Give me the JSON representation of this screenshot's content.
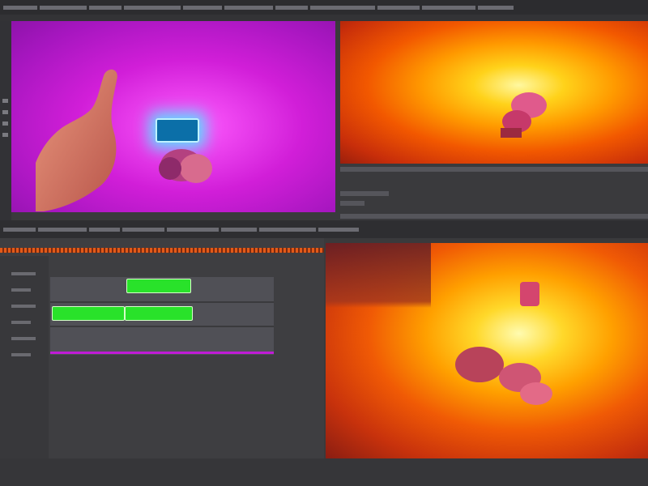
{
  "app": {
    "title": ""
  },
  "viewer_top_left": {
    "label": "",
    "background": "#c81bd0",
    "screen_glow": "#29b7ff"
  },
  "viewer_top_right": {
    "label": "",
    "background": "#ff6a00"
  },
  "viewer_bottom_right": {
    "label": "",
    "background": "#ff6a00"
  },
  "timeline": {
    "label": "",
    "tracks": [
      {
        "clips": [
          {
            "color": "#29e22a",
            "label": ""
          }
        ]
      },
      {
        "clips": [
          {
            "color": "#29e22a",
            "label": ""
          },
          {
            "color": "#29e22a",
            "label": ""
          }
        ]
      },
      {
        "clips": []
      }
    ],
    "playhead_color": "#c01bd6",
    "ruler_color": "#e25a18"
  },
  "status": {
    "text": ""
  }
}
